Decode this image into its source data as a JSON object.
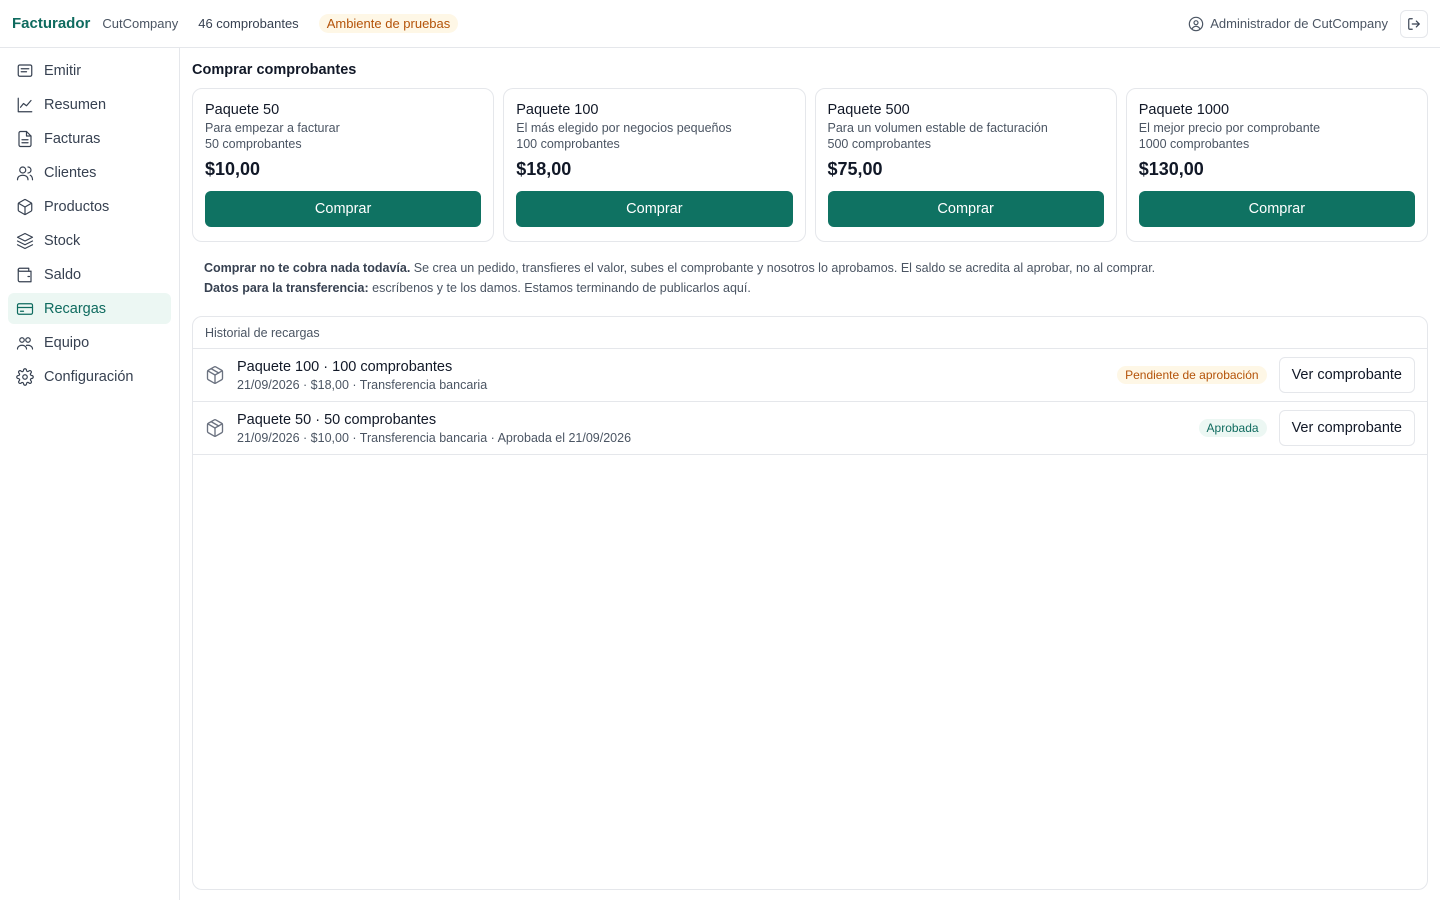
{
  "topbar": {
    "brand": "Facturador",
    "company": "CutCompany",
    "count": "46 comprobantes",
    "environment": "Ambiente de pruebas",
    "user": "Administrador de CutCompany",
    "user_icon": "user-circle-icon",
    "logout_icon": "logout-icon"
  },
  "colors": {
    "accent": "#0f7262",
    "active_bg": "#ecf7f3",
    "warning_text": "#b45309",
    "warning_bg": "#fef7e6"
  },
  "sidebar": {
    "items": [
      {
        "label": "Emitir",
        "icon": "receipt-icon"
      },
      {
        "label": "Resumen",
        "icon": "chart-line-icon"
      },
      {
        "label": "Facturas",
        "icon": "document-icon"
      },
      {
        "label": "Clientes",
        "icon": "users-icon"
      },
      {
        "label": "Productos",
        "icon": "box-icon"
      },
      {
        "label": "Stock",
        "icon": "layers-icon"
      },
      {
        "label": "Saldo",
        "icon": "wallet-icon"
      },
      {
        "label": "Recargas",
        "icon": "credit-card-icon",
        "active": true
      },
      {
        "label": "Equipo",
        "icon": "team-icon"
      },
      {
        "label": "Configuración",
        "icon": "gear-icon"
      }
    ]
  },
  "main": {
    "title": "Comprar comprobantes",
    "packages": [
      {
        "name": "Paquete 50",
        "description": "Para empezar a facturar",
        "quantity": "50 comprobantes",
        "price": "$10,00",
        "button": "Comprar"
      },
      {
        "name": "Paquete 100",
        "description": "El más elegido por negocios pequeños",
        "quantity": "100 comprobantes",
        "price": "$18,00",
        "button": "Comprar"
      },
      {
        "name": "Paquete 500",
        "description": "Para un volumen estable de facturación",
        "quantity": "500 comprobantes",
        "price": "$75,00",
        "button": "Comprar"
      },
      {
        "name": "Paquete 1000",
        "description": "El mejor precio por comprobante",
        "quantity": "1000 comprobantes",
        "price": "$130,00",
        "button": "Comprar"
      }
    ],
    "note": {
      "line1_bold": "Comprar no te cobra nada todavía.",
      "line1_rest": " Se crea un pedido, transfieres el valor, subes el comprobante y nosotros lo aprobamos. El saldo se acredita al aprobar, no al comprar.",
      "line2_bold": "Datos para la transferencia:",
      "line2_rest": " escríbenos y te los damos. Estamos terminando de publicarlos aquí."
    },
    "history": {
      "title": "Historial de recargas",
      "rows": [
        {
          "title": "Paquete 100 · 100 comprobantes",
          "subtitle": "21/09/2026 · $18,00 · Transferencia bancaria",
          "status": "Pendiente de aprobación",
          "action": "Ver comprobante"
        },
        {
          "title": "Paquete 50 · 50 comprobantes",
          "subtitle": "21/09/2026 · $10,00 · Transferencia bancaria · Aprobada el 21/09/2026",
          "status": "Aprobada",
          "action": "Ver comprobante"
        }
      ]
    }
  }
}
